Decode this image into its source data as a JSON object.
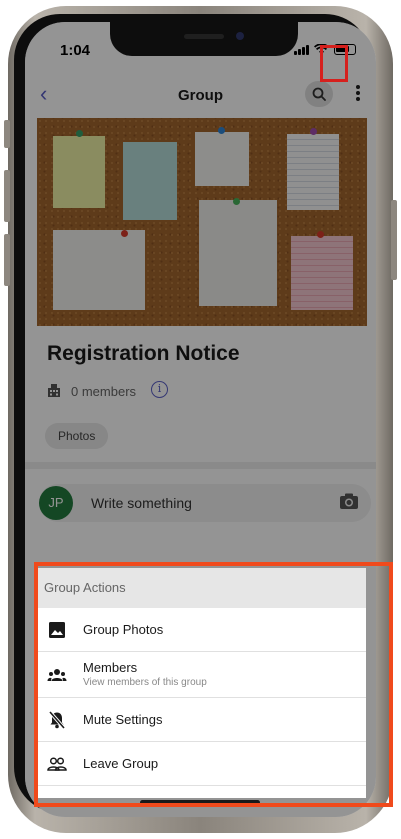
{
  "status": {
    "time": "1:04"
  },
  "header": {
    "title": "Group"
  },
  "group": {
    "name": "Registration Notice",
    "members": "0 members",
    "chip": "Photos"
  },
  "composer": {
    "avatar_initials": "JP",
    "placeholder": "Write something"
  },
  "sheet": {
    "title": "Group Actions",
    "items": [
      {
        "label": "Group Photos",
        "subtitle": "",
        "icon": "image-icon"
      },
      {
        "label": "Members",
        "subtitle": "View members of this group",
        "icon": "people-icon"
      },
      {
        "label": "Mute Settings",
        "subtitle": "",
        "icon": "bell-off-icon"
      },
      {
        "label": "Leave Group",
        "subtitle": "",
        "icon": "people-outline-icon"
      }
    ]
  },
  "colors": {
    "accent": "#5b5fc7",
    "highlight_red": "#d6201d",
    "highlight_orange": "#f04a1c",
    "avatar_green": "#237b3e"
  }
}
